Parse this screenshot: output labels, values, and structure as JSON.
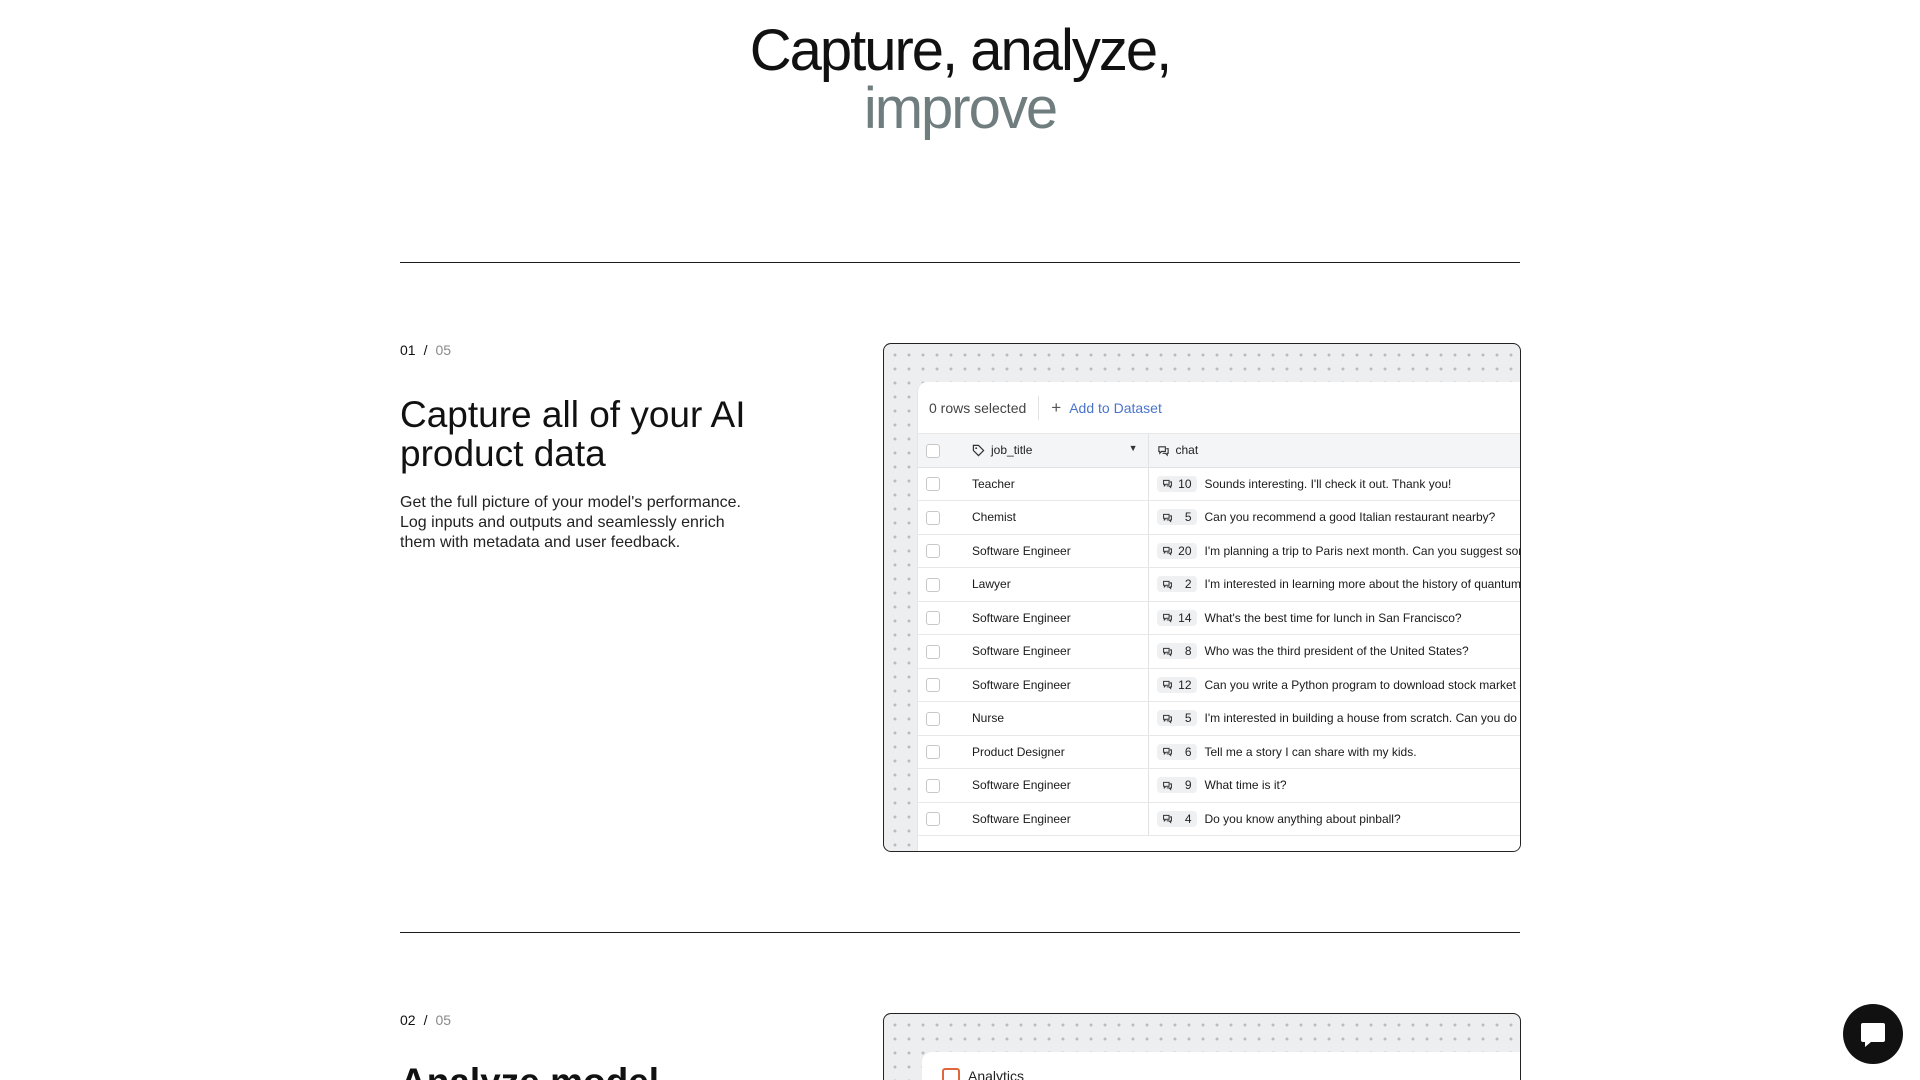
{
  "hero": {
    "line1": "Capture, analyze,",
    "line2": "improve"
  },
  "feature1": {
    "step_current": "01",
    "step_sep": "/",
    "step_total": "05",
    "title": "Capture all of your AI product data",
    "description": "Get the full picture of your model's performance. Log inputs and outputs and seamlessly enrich them with metadata and user feedback."
  },
  "table_panel": {
    "selected_label": "0 rows selected",
    "add_label": "Add to Dataset",
    "columns": {
      "job": "job_title",
      "chat": "chat"
    },
    "rows": [
      {
        "job": "Teacher",
        "count": "10",
        "text": "Sounds interesting. I'll check it out. Thank you!"
      },
      {
        "job": "Chemist",
        "count": "5",
        "text": "Can you recommend a good Italian restaurant nearby?"
      },
      {
        "job": "Software Engineer",
        "count": "20",
        "text": "I'm planning a trip to Paris next month. Can you suggest some"
      },
      {
        "job": "Lawyer",
        "count": "2",
        "text": "I'm interested in learning more about the history of quantum p"
      },
      {
        "job": "Software Engineer",
        "count": "14",
        "text": "What's the best time for lunch in San Francisco?"
      },
      {
        "job": "Software Engineer",
        "count": "8",
        "text": "Who was the third president of the United States?"
      },
      {
        "job": "Software Engineer",
        "count": "12",
        "text": "Can you write a Python program to download stock market dat"
      },
      {
        "job": "Nurse",
        "count": "5",
        "text": "I'm interested in building a house from scratch. Can you do so"
      },
      {
        "job": "Product Designer",
        "count": "6",
        "text": "Tell me a story I can share with my kids."
      },
      {
        "job": "Software Engineer",
        "count": "9",
        "text": "What time is it?"
      },
      {
        "job": "Software Engineer",
        "count": "4",
        "text": "Do you know anything about pinball?"
      }
    ]
  },
  "feature2": {
    "step_current": "02",
    "step_sep": "/",
    "step_total": "05",
    "title": "Analyze model",
    "panel_label": "Analytics"
  },
  "colors": {
    "accent_link": "#4a74c9",
    "muted_heading": "#6f7d7f",
    "analytics_icon": "#e0673b"
  }
}
